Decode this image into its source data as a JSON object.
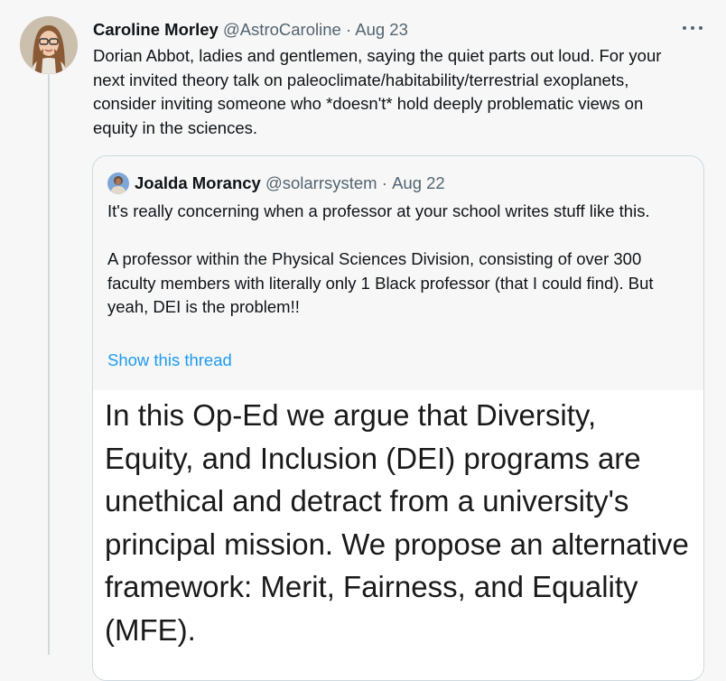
{
  "tweet": {
    "display_name": "Caroline Morley",
    "handle": "@AstroCaroline",
    "separator": "·",
    "date": "Aug 23",
    "text": "Dorian Abbot, ladies and gentlemen, saying the quiet parts out loud. For your next invited theory talk on paleoclimate/habitability/terrestrial exoplanets, consider inviting someone who *doesn't* hold deeply problematic views on equity in the sciences."
  },
  "quote": {
    "display_name": "Joalda Morancy",
    "handle": "@solarrsystem",
    "separator": "·",
    "date": "Aug 22",
    "text": "It's really concerning when a professor at your school writes stuff like this.\n\nA professor within the Physical Sciences Division, consisting of over 300 faculty members with literally only 1 Black professor (that I could find). But yeah, DEI is the problem!!",
    "show_thread": "Show this thread",
    "media_text": "In this Op-Ed we argue that Diversity, Equity, and Inclusion (DEI) programs are unethical and detract from a university's principal mission. We propose an alternative framework: Merit, Fairness, and Equality (MFE)."
  },
  "colors": {
    "link": "#1d9bf0",
    "secondary_text": "#536471",
    "border": "#cfd9de"
  },
  "icons": {
    "more": "more-horizontal-icon"
  }
}
